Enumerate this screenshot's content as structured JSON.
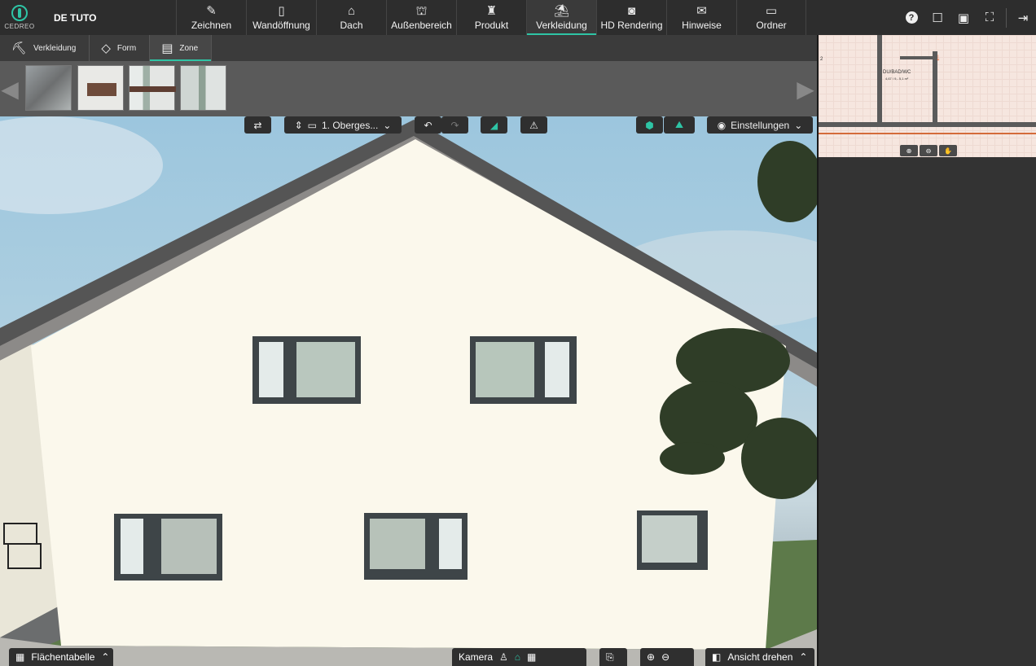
{
  "app": {
    "logo_text": "CEDREO",
    "project_name": "DE TUTO"
  },
  "menu": [
    {
      "label": "Zeichnen",
      "icon": "✎"
    },
    {
      "label": "Wandöffnung",
      "icon": "▯"
    },
    {
      "label": "Dach",
      "icon": "⌂"
    },
    {
      "label": "Außenbereich",
      "icon": "⛫"
    },
    {
      "label": "Produkt",
      "icon": "♜"
    },
    {
      "label": "Verkleidung",
      "icon": "⛱"
    },
    {
      "label": "HD Rendering",
      "icon": "◙"
    },
    {
      "label": "Hinweise",
      "icon": "✉"
    },
    {
      "label": "Ordner",
      "icon": "▭"
    }
  ],
  "topright": {
    "help": "?",
    "comment_icon": "☐",
    "save_icon": "▣",
    "fullscreen_icon": "⛶",
    "logout_icon": "⇥"
  },
  "subtabs": [
    {
      "label": "Verkleidung",
      "icon": "⛏"
    },
    {
      "label": "Form",
      "icon": "◇"
    },
    {
      "label": "Zone",
      "icon": "▤"
    }
  ],
  "viewport": {
    "level_label": "1. Oberges...",
    "settings_label": "Einstellungen"
  },
  "plan": {
    "room_label": "DU/BAD/WC",
    "room_sub": "4,67 / 9,- 5,1 m²",
    "left_label": "2"
  },
  "bottom": {
    "area_table": "Flächentabelle",
    "camera": "Kamera",
    "rotate": "Ansicht drehen"
  }
}
